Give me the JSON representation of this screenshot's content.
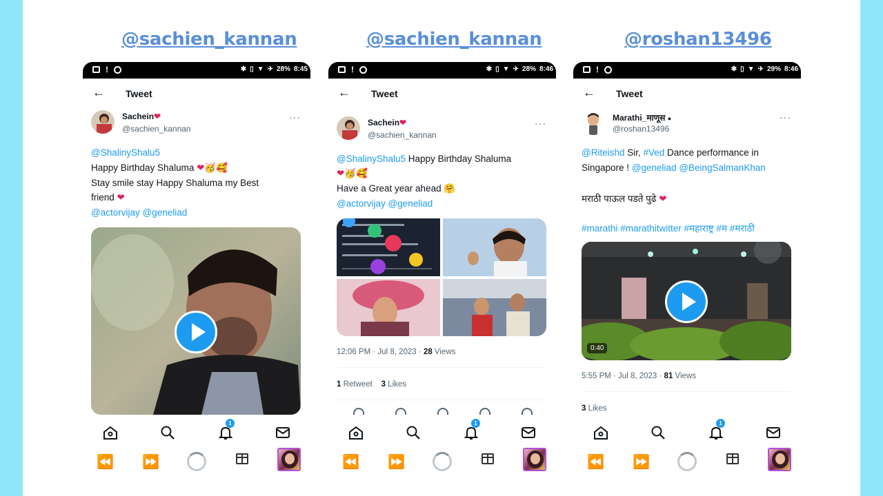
{
  "handles": [
    "@sachien_kannan",
    "@sachien_kannan",
    "@roshan13496"
  ],
  "status": {
    "battery_p1": "28%",
    "battery_p2": "28%",
    "battery_p3": "29%",
    "time_p1": "8:45",
    "time_p2": "8:46",
    "time_p3": "8:46"
  },
  "header": {
    "back": "←",
    "title": "Tweet",
    "more": "···"
  },
  "p1": {
    "name": "Sachein",
    "handle": "@sachien_kannan",
    "mention": "@ShalinyShalu5",
    "line2": "Happy Birthday Shaluma",
    "line3": "Stay smile stay Happy Shaluma my Best",
    "line4": "friend",
    "mentions2": "@actorvijay @geneliad"
  },
  "p2": {
    "name": "Sachein",
    "handle": "@sachien_kannan",
    "mention": "@ShalinyShalu5",
    "line1_rest": "Happy Birthday Shaluma",
    "line3": "Have a Great year ahead",
    "mentions2": "@actorvijay @geneliad",
    "timestamp": "12:06 PM · Jul 8, 2023 · ",
    "views_count": "28",
    "views_label": " Views",
    "retweets_count": "1",
    "retweets_label": " Retweet",
    "likes_count": "3",
    "likes_label": " Likes"
  },
  "p3": {
    "name": "Marathi_माणूस",
    "handle": "@roshan13496",
    "l1_mention": "@Riteishd",
    "l1_mid": " Sir, ",
    "l1_tag": "#Ved",
    "l1_rest": " Dance performance in",
    "l2_text": "Singapore ! ",
    "l2_mentions": "@geneliad @BeingSalmanKhan",
    "l3": "मराठी पाऊल पडते पुढे",
    "l4": "#marathi #marathitwitter #महाराष्ट्र #म #मराठी",
    "video_time": "0:40",
    "timestamp": "5:55 PM · Jul 8, 2023 · ",
    "views_count": "81",
    "views_label": " Views",
    "likes_count": "3",
    "likes_label": " Likes"
  },
  "nav": {
    "badge": "1"
  },
  "icons": [
    "back-arrow-icon",
    "more-icon",
    "home-icon",
    "search-icon",
    "bell-icon",
    "mail-icon",
    "rewind-icon",
    "forward-icon",
    "loading-ring-icon",
    "gift-icon",
    "play-icon"
  ],
  "colors": {
    "link": "#1d9bf0",
    "heart": "#e0245e",
    "handle_text": "#5a8fd8",
    "frame": "#8fe6f8"
  }
}
